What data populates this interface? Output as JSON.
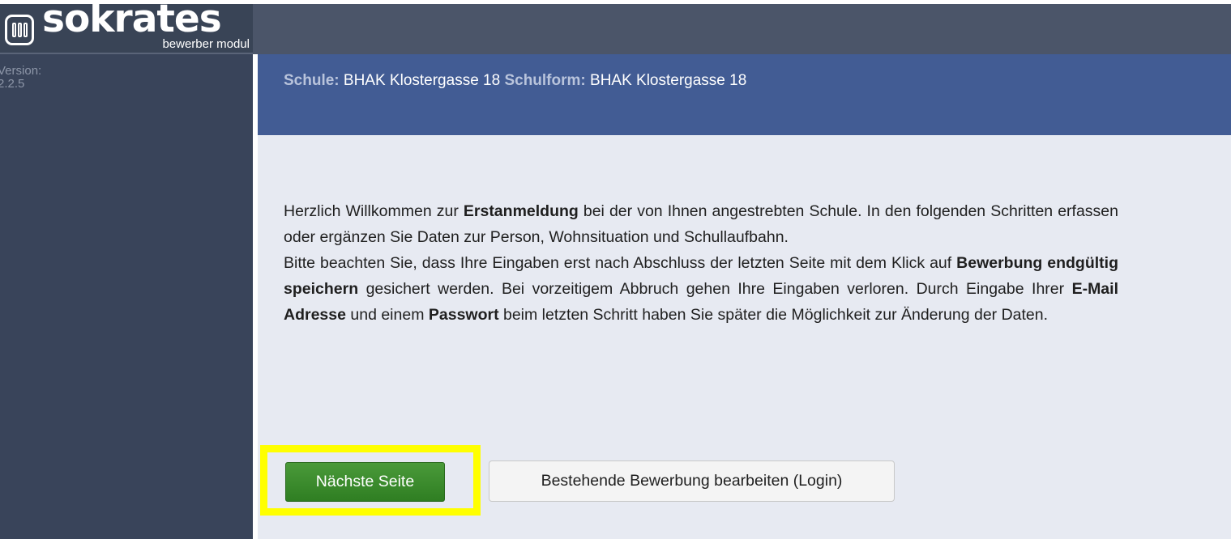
{
  "logo": {
    "wordmark": "sokrates",
    "subtitle": "bewerber modul",
    "icon": "bookshelf-icon"
  },
  "sidebar": {
    "version_label": "Version:",
    "version_value": "2.2.5"
  },
  "header": {
    "school_label": "Schule:",
    "school_value": "BHAK Klostergasse 18",
    "schoolform_label": "Schulform:",
    "schoolform_value": "BHAK Klostergasse 18"
  },
  "intro": {
    "p1_a": "Herzlich Willkommen zur ",
    "p1_b": "Erstanmeldung",
    "p1_c": " bei der von Ihnen angestrebten Schule. In den folgenden Schritten erfassen oder ergänzen Sie Daten zur Person, Wohnsituation und Schullaufbahn.",
    "p2_a": "Bitte beachten Sie, dass Ihre Eingaben erst nach Abschluss der letzten Seite mit dem Klick auf ",
    "p2_b": "Bewerbung endgültig speichern",
    "p2_c": " gesichert werden. Bei vorzeitigem Abbruch gehen Ihre Eingaben verloren. Durch Eingabe Ihrer ",
    "p2_d": "E-Mail Adresse",
    "p2_e": " und einem ",
    "p2_f": "Passwort",
    "p2_g": " beim letzten Schritt haben Sie später die Möglichkeit zur Änderung der Daten."
  },
  "actions": {
    "next_label": "Nächste Seite",
    "login_label": "Bestehende Bewerbung bearbeiten (Login)"
  },
  "colors": {
    "topbar": "#4b5569",
    "sidebar": "#39445a",
    "band": "#425c94",
    "content": "#e7eaf2",
    "next_button": "#2f7e22",
    "highlight": "#ffff00"
  }
}
